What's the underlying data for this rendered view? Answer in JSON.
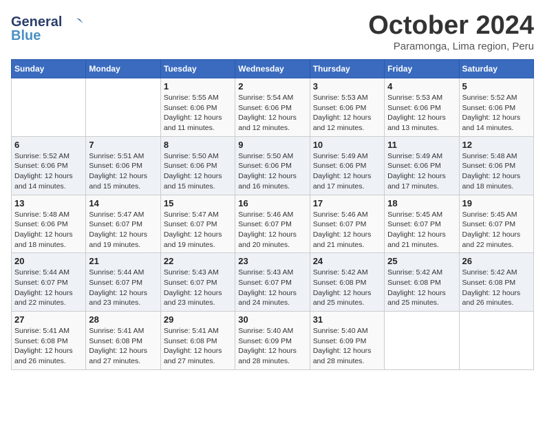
{
  "header": {
    "logo_general": "General",
    "logo_blue": "Blue",
    "month_title": "October 2024",
    "subtitle": "Paramonga, Lima region, Peru"
  },
  "days_of_week": [
    "Sunday",
    "Monday",
    "Tuesday",
    "Wednesday",
    "Thursday",
    "Friday",
    "Saturday"
  ],
  "weeks": [
    [
      {
        "day": "",
        "sunrise": "",
        "sunset": "",
        "daylight": ""
      },
      {
        "day": "",
        "sunrise": "",
        "sunset": "",
        "daylight": ""
      },
      {
        "day": "1",
        "sunrise": "Sunrise: 5:55 AM",
        "sunset": "Sunset: 6:06 PM",
        "daylight": "Daylight: 12 hours and 11 minutes."
      },
      {
        "day": "2",
        "sunrise": "Sunrise: 5:54 AM",
        "sunset": "Sunset: 6:06 PM",
        "daylight": "Daylight: 12 hours and 12 minutes."
      },
      {
        "day": "3",
        "sunrise": "Sunrise: 5:53 AM",
        "sunset": "Sunset: 6:06 PM",
        "daylight": "Daylight: 12 hours and 12 minutes."
      },
      {
        "day": "4",
        "sunrise": "Sunrise: 5:53 AM",
        "sunset": "Sunset: 6:06 PM",
        "daylight": "Daylight: 12 hours and 13 minutes."
      },
      {
        "day": "5",
        "sunrise": "Sunrise: 5:52 AM",
        "sunset": "Sunset: 6:06 PM",
        "daylight": "Daylight: 12 hours and 14 minutes."
      }
    ],
    [
      {
        "day": "6",
        "sunrise": "Sunrise: 5:52 AM",
        "sunset": "Sunset: 6:06 PM",
        "daylight": "Daylight: 12 hours and 14 minutes."
      },
      {
        "day": "7",
        "sunrise": "Sunrise: 5:51 AM",
        "sunset": "Sunset: 6:06 PM",
        "daylight": "Daylight: 12 hours and 15 minutes."
      },
      {
        "day": "8",
        "sunrise": "Sunrise: 5:50 AM",
        "sunset": "Sunset: 6:06 PM",
        "daylight": "Daylight: 12 hours and 15 minutes."
      },
      {
        "day": "9",
        "sunrise": "Sunrise: 5:50 AM",
        "sunset": "Sunset: 6:06 PM",
        "daylight": "Daylight: 12 hours and 16 minutes."
      },
      {
        "day": "10",
        "sunrise": "Sunrise: 5:49 AM",
        "sunset": "Sunset: 6:06 PM",
        "daylight": "Daylight: 12 hours and 17 minutes."
      },
      {
        "day": "11",
        "sunrise": "Sunrise: 5:49 AM",
        "sunset": "Sunset: 6:06 PM",
        "daylight": "Daylight: 12 hours and 17 minutes."
      },
      {
        "day": "12",
        "sunrise": "Sunrise: 5:48 AM",
        "sunset": "Sunset: 6:06 PM",
        "daylight": "Daylight: 12 hours and 18 minutes."
      }
    ],
    [
      {
        "day": "13",
        "sunrise": "Sunrise: 5:48 AM",
        "sunset": "Sunset: 6:06 PM",
        "daylight": "Daylight: 12 hours and 18 minutes."
      },
      {
        "day": "14",
        "sunrise": "Sunrise: 5:47 AM",
        "sunset": "Sunset: 6:07 PM",
        "daylight": "Daylight: 12 hours and 19 minutes."
      },
      {
        "day": "15",
        "sunrise": "Sunrise: 5:47 AM",
        "sunset": "Sunset: 6:07 PM",
        "daylight": "Daylight: 12 hours and 19 minutes."
      },
      {
        "day": "16",
        "sunrise": "Sunrise: 5:46 AM",
        "sunset": "Sunset: 6:07 PM",
        "daylight": "Daylight: 12 hours and 20 minutes."
      },
      {
        "day": "17",
        "sunrise": "Sunrise: 5:46 AM",
        "sunset": "Sunset: 6:07 PM",
        "daylight": "Daylight: 12 hours and 21 minutes."
      },
      {
        "day": "18",
        "sunrise": "Sunrise: 5:45 AM",
        "sunset": "Sunset: 6:07 PM",
        "daylight": "Daylight: 12 hours and 21 minutes."
      },
      {
        "day": "19",
        "sunrise": "Sunrise: 5:45 AM",
        "sunset": "Sunset: 6:07 PM",
        "daylight": "Daylight: 12 hours and 22 minutes."
      }
    ],
    [
      {
        "day": "20",
        "sunrise": "Sunrise: 5:44 AM",
        "sunset": "Sunset: 6:07 PM",
        "daylight": "Daylight: 12 hours and 22 minutes."
      },
      {
        "day": "21",
        "sunrise": "Sunrise: 5:44 AM",
        "sunset": "Sunset: 6:07 PM",
        "daylight": "Daylight: 12 hours and 23 minutes."
      },
      {
        "day": "22",
        "sunrise": "Sunrise: 5:43 AM",
        "sunset": "Sunset: 6:07 PM",
        "daylight": "Daylight: 12 hours and 23 minutes."
      },
      {
        "day": "23",
        "sunrise": "Sunrise: 5:43 AM",
        "sunset": "Sunset: 6:07 PM",
        "daylight": "Daylight: 12 hours and 24 minutes."
      },
      {
        "day": "24",
        "sunrise": "Sunrise: 5:42 AM",
        "sunset": "Sunset: 6:08 PM",
        "daylight": "Daylight: 12 hours and 25 minutes."
      },
      {
        "day": "25",
        "sunrise": "Sunrise: 5:42 AM",
        "sunset": "Sunset: 6:08 PM",
        "daylight": "Daylight: 12 hours and 25 minutes."
      },
      {
        "day": "26",
        "sunrise": "Sunrise: 5:42 AM",
        "sunset": "Sunset: 6:08 PM",
        "daylight": "Daylight: 12 hours and 26 minutes."
      }
    ],
    [
      {
        "day": "27",
        "sunrise": "Sunrise: 5:41 AM",
        "sunset": "Sunset: 6:08 PM",
        "daylight": "Daylight: 12 hours and 26 minutes."
      },
      {
        "day": "28",
        "sunrise": "Sunrise: 5:41 AM",
        "sunset": "Sunset: 6:08 PM",
        "daylight": "Daylight: 12 hours and 27 minutes."
      },
      {
        "day": "29",
        "sunrise": "Sunrise: 5:41 AM",
        "sunset": "Sunset: 6:08 PM",
        "daylight": "Daylight: 12 hours and 27 minutes."
      },
      {
        "day": "30",
        "sunrise": "Sunrise: 5:40 AM",
        "sunset": "Sunset: 6:09 PM",
        "daylight": "Daylight: 12 hours and 28 minutes."
      },
      {
        "day": "31",
        "sunrise": "Sunrise: 5:40 AM",
        "sunset": "Sunset: 6:09 PM",
        "daylight": "Daylight: 12 hours and 28 minutes."
      },
      {
        "day": "",
        "sunrise": "",
        "sunset": "",
        "daylight": ""
      },
      {
        "day": "",
        "sunrise": "",
        "sunset": "",
        "daylight": ""
      }
    ]
  ]
}
